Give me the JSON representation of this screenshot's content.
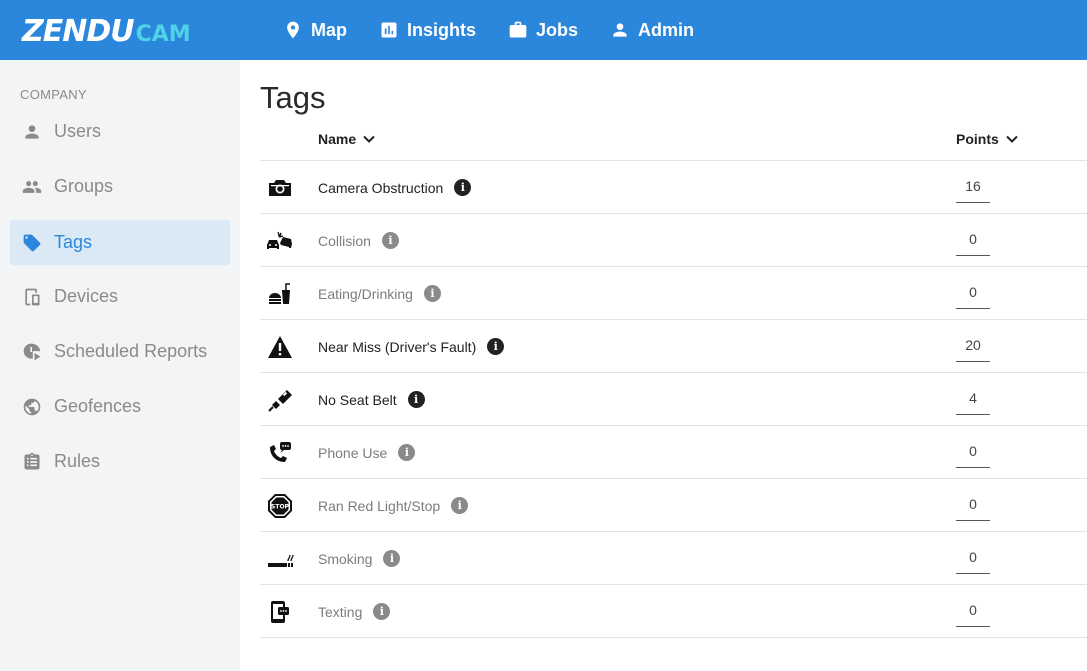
{
  "brand": {
    "part1": "ZENDU",
    "part2": "CAM"
  },
  "nav": [
    {
      "label": "Map",
      "icon": "map-pin-icon"
    },
    {
      "label": "Insights",
      "icon": "bar-chart-icon"
    },
    {
      "label": "Jobs",
      "icon": "briefcase-icon"
    },
    {
      "label": "Admin",
      "icon": "person-icon"
    }
  ],
  "sidebar": {
    "section": "COMPANY",
    "items": [
      {
        "label": "Users",
        "icon": "user-icon"
      },
      {
        "label": "Groups",
        "icon": "group-icon"
      },
      {
        "label": "Tags",
        "icon": "tag-icon",
        "active": true
      },
      {
        "label": "Devices",
        "icon": "devices-icon"
      },
      {
        "label": "Scheduled Reports",
        "icon": "clock-report-icon"
      },
      {
        "label": "Geofences",
        "icon": "globe-icon"
      },
      {
        "label": "Rules",
        "icon": "clipboard-icon"
      }
    ]
  },
  "page": {
    "title": "Tags"
  },
  "table": {
    "col_name": "Name",
    "col_points": "Points",
    "rows": [
      {
        "name": "Camera Obstruction",
        "points": "16",
        "icon": "camera-icon",
        "enabled": true
      },
      {
        "name": "Collision",
        "points": "0",
        "icon": "car-collision-icon",
        "enabled": false
      },
      {
        "name": "Eating/Drinking",
        "points": "0",
        "icon": "fast-food-icon",
        "enabled": false
      },
      {
        "name": "Near Miss (Driver's Fault)",
        "points": "20",
        "icon": "warning-icon",
        "enabled": true
      },
      {
        "name": "No Seat Belt",
        "points": "4",
        "icon": "seat-belt-icon",
        "enabled": true
      },
      {
        "name": "Phone Use",
        "points": "0",
        "icon": "phone-call-icon",
        "enabled": false
      },
      {
        "name": "Ran Red Light/Stop",
        "points": "0",
        "icon": "stop-sign-icon",
        "enabled": false
      },
      {
        "name": "Smoking",
        "points": "0",
        "icon": "smoking-icon",
        "enabled": false
      },
      {
        "name": "Texting",
        "points": "0",
        "icon": "texting-icon",
        "enabled": false
      }
    ]
  },
  "info_glyph": "i",
  "stop_text": "STOP",
  "colors": {
    "topbar": "#2b87dc",
    "cam": "#4fd1e8",
    "active_bg": "#dbe8f5",
    "sidebar_bg": "#f3f4f6"
  }
}
